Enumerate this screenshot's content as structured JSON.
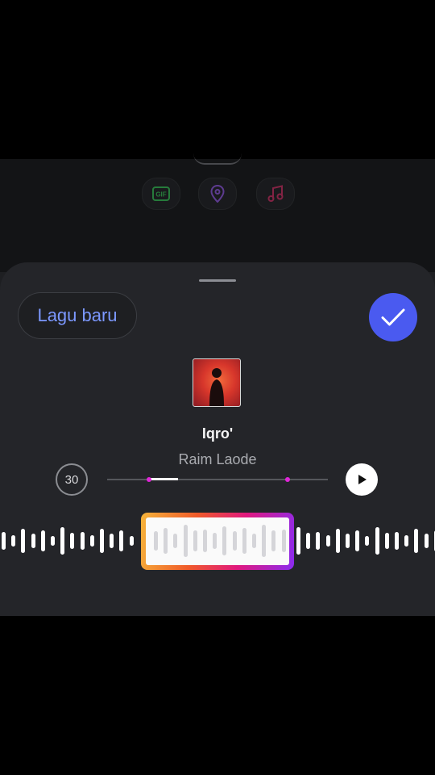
{
  "background_stickers": [
    {
      "name": "gif-sticker",
      "label": "GIF",
      "color": "#37d05a"
    },
    {
      "name": "location-sticker",
      "label": "",
      "color": "#9b5cf5"
    },
    {
      "name": "music-sticker",
      "label": "",
      "color": "#e0306b"
    }
  ],
  "sheet": {
    "new_song_label": "Lagu baru",
    "done_icon": "check-icon",
    "song": {
      "title": "Iqro'",
      "artist": "Raim Laode"
    },
    "duration_label": "30",
    "play_icon": "play-icon",
    "accent_color": "#4a5af0",
    "selection_gradient": [
      "#f6b43a",
      "#f05a2a",
      "#e0187e",
      "#8b2cf0"
    ]
  }
}
